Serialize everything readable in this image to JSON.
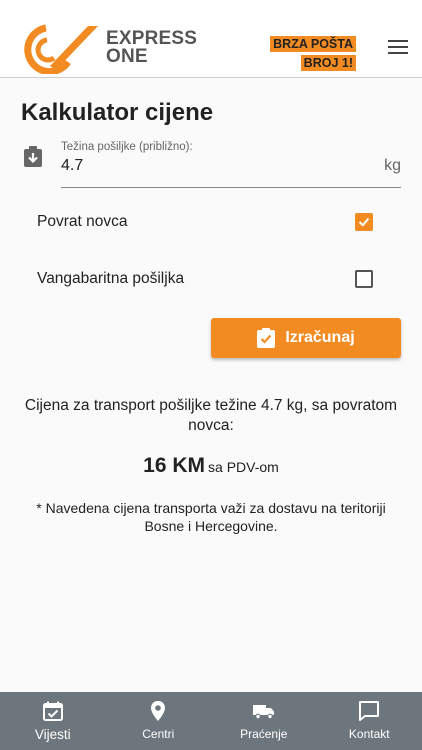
{
  "header": {
    "brand_line1": "EXPRESS",
    "brand_line2": "ONE",
    "slogan_line1": "BRZA POŠTA",
    "slogan_line2": "BROJ 1!",
    "menu_icon": "hamburger-menu-icon",
    "colors": {
      "brand_orange": "#f28b22",
      "brand_gray": "#555555"
    }
  },
  "page": {
    "title": "Kalkulator cijene"
  },
  "weight_field": {
    "label": "Težina pošiljke (približno):",
    "value": "4.7",
    "unit": "kg",
    "icon": "weight-download-icon"
  },
  "options": [
    {
      "label": "Povrat novca",
      "checked": true
    },
    {
      "label": "Vangabaritna pošiljka",
      "checked": false
    }
  ],
  "calculate_button": {
    "label": "Izračunaj",
    "icon": "clipboard-check-icon"
  },
  "result": {
    "description": "Cijena za transport pošiljke težine 4.7 kg, sa povratom novca:",
    "amount": "16 KM",
    "vat_note": "sa PDV-om",
    "footnote": "* Navedena cijena transporta važi za dostavu na teritoriji Bosne i Hercegovine."
  },
  "tabbar": {
    "tabs": [
      {
        "label": "Vijesti",
        "icon": "calendar-check-icon",
        "active": true
      },
      {
        "label": "Centri",
        "icon": "location-pin-icon",
        "active": false
      },
      {
        "label": "Praćenje",
        "icon": "truck-icon",
        "active": false
      },
      {
        "label": "Kontakt",
        "icon": "chat-bubble-icon",
        "active": false
      }
    ],
    "background": "#6d767d"
  }
}
